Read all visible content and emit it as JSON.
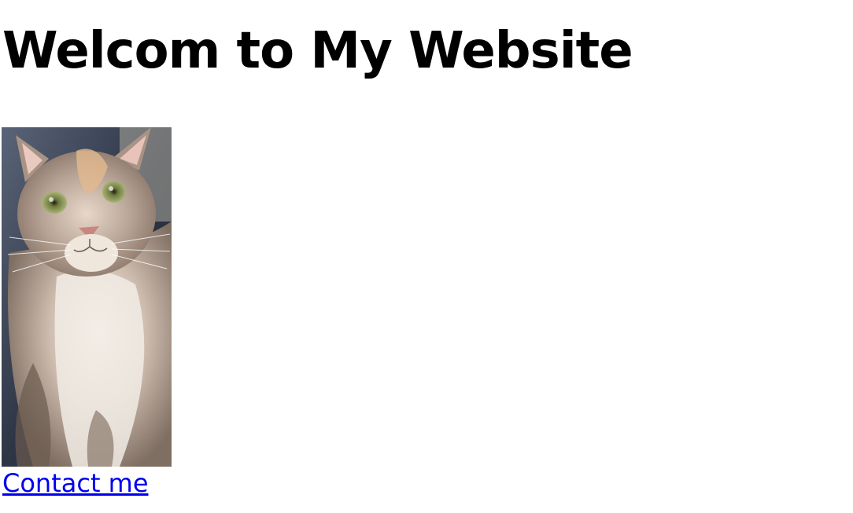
{
  "page": {
    "heading": "Welcom to My Website",
    "contact_link": "Contact me",
    "link_color": "#0000ee"
  },
  "image": {
    "subject": "fluffy calico cat photo",
    "icon": "cat-photo"
  }
}
